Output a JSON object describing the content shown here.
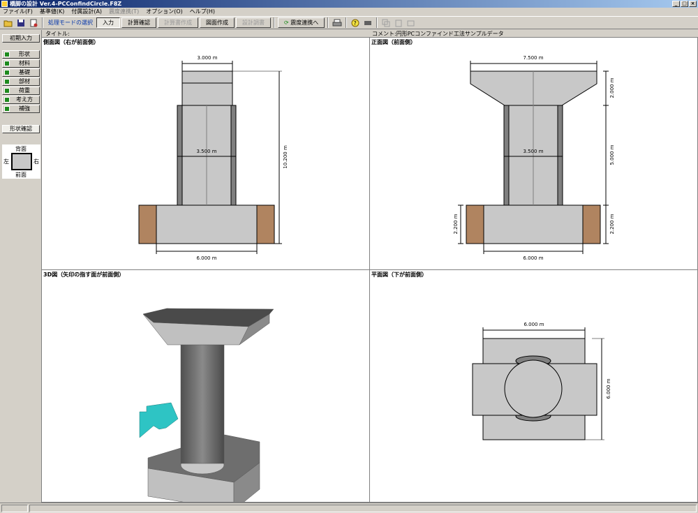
{
  "window": {
    "title": "橋脚の設計 Ver.4-PCConfindCircle.F8Z"
  },
  "menu": [
    {
      "label": "ファイル(F)",
      "enabled": true
    },
    {
      "label": "基準値(K)",
      "enabled": true
    },
    {
      "label": "付属設計(A)",
      "enabled": true
    },
    {
      "label": "震度連携(T)",
      "enabled": false
    },
    {
      "label": "オプション(O)",
      "enabled": true
    },
    {
      "label": "ヘルプ(H)",
      "enabled": true
    }
  ],
  "toolbar": {
    "mode_label": "処理モードの選択",
    "input": "入力",
    "calc_check": "計算確認",
    "calc_report": "計算書作成",
    "drawing": "図面作成",
    "design_report": "設計調書",
    "seismic_link": "震度連携へ"
  },
  "sidebar": {
    "initial_input": "初期入力",
    "items": [
      "形状",
      "材料",
      "基礎",
      "部材",
      "荷重",
      "考え方",
      "補強"
    ],
    "shape_check": "形状確認",
    "shape_box": {
      "back": "背面",
      "front": "前面",
      "left": "左",
      "right": "右"
    }
  },
  "header": {
    "title_label": "タイトル:",
    "comment_label": "コメント:円形PCコンファインド工法サンプルデータ"
  },
  "panes": {
    "side": {
      "title": "側面図（右が前面側）",
      "dims": {
        "top_width": "3.000 m",
        "mid_width": "3.500 m",
        "height": "10.200 m",
        "footing_width": "6.000 m"
      }
    },
    "front": {
      "title": "正面図（前面側）",
      "dims": {
        "top_width": "7.500 m",
        "mid_width": "3.500 m",
        "footing_width": "6.000 m",
        "beam_h": "2.000 m",
        "column_h": "5.000 m",
        "footing_h_right": "2.200 m",
        "footing_h_left": "2.200 m"
      }
    },
    "view3d": {
      "title": "3D図（矢印の指す面が前面側）"
    },
    "plan": {
      "title": "平面図（下が前面側）",
      "dims": {
        "top_width": "6.000 m",
        "side_height": "6.000 m"
      }
    }
  },
  "colors": {
    "concrete": "#c8c8c8",
    "column_dark": "#808080",
    "soil": "#b08460",
    "arrow": "#2ec4c4"
  }
}
